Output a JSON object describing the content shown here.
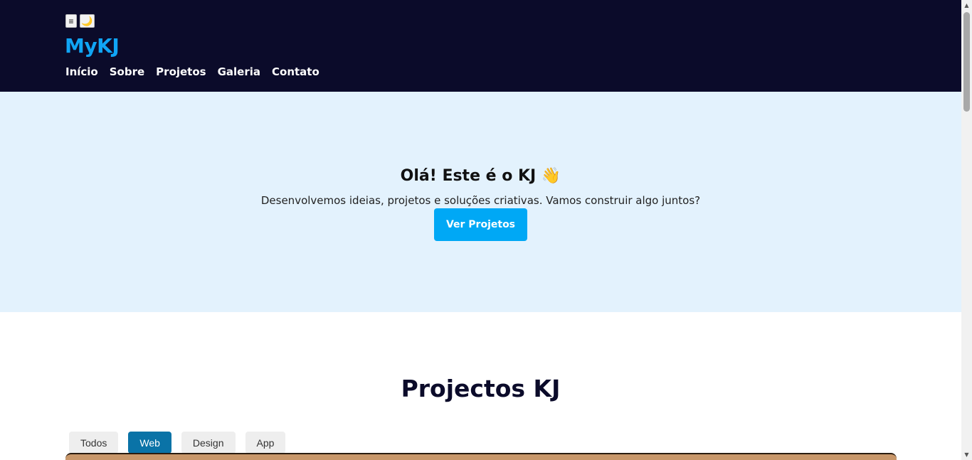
{
  "header": {
    "icons": {
      "menu": "≡",
      "theme": "🌙"
    },
    "logo": "MyKJ",
    "nav": [
      "Início",
      "Sobre",
      "Projetos",
      "Galeria",
      "Contato"
    ]
  },
  "hero": {
    "title": "Olá! Este é o KJ",
    "wave": "👋",
    "subtitle": "Desenvolvemos ideias, projetos e soluções criativas. Vamos construir algo juntos?",
    "button": "Ver Projetos"
  },
  "projects": {
    "title": "Projectos KJ",
    "filters": [
      "Todos",
      "Web",
      "Design",
      "App"
    ],
    "active_filter": "Web"
  },
  "colors": {
    "header_bg": "#0b0b2a",
    "accent": "#10a5f5",
    "hero_bg": "#e3f2fd",
    "active_filter": "#0a73a7"
  }
}
